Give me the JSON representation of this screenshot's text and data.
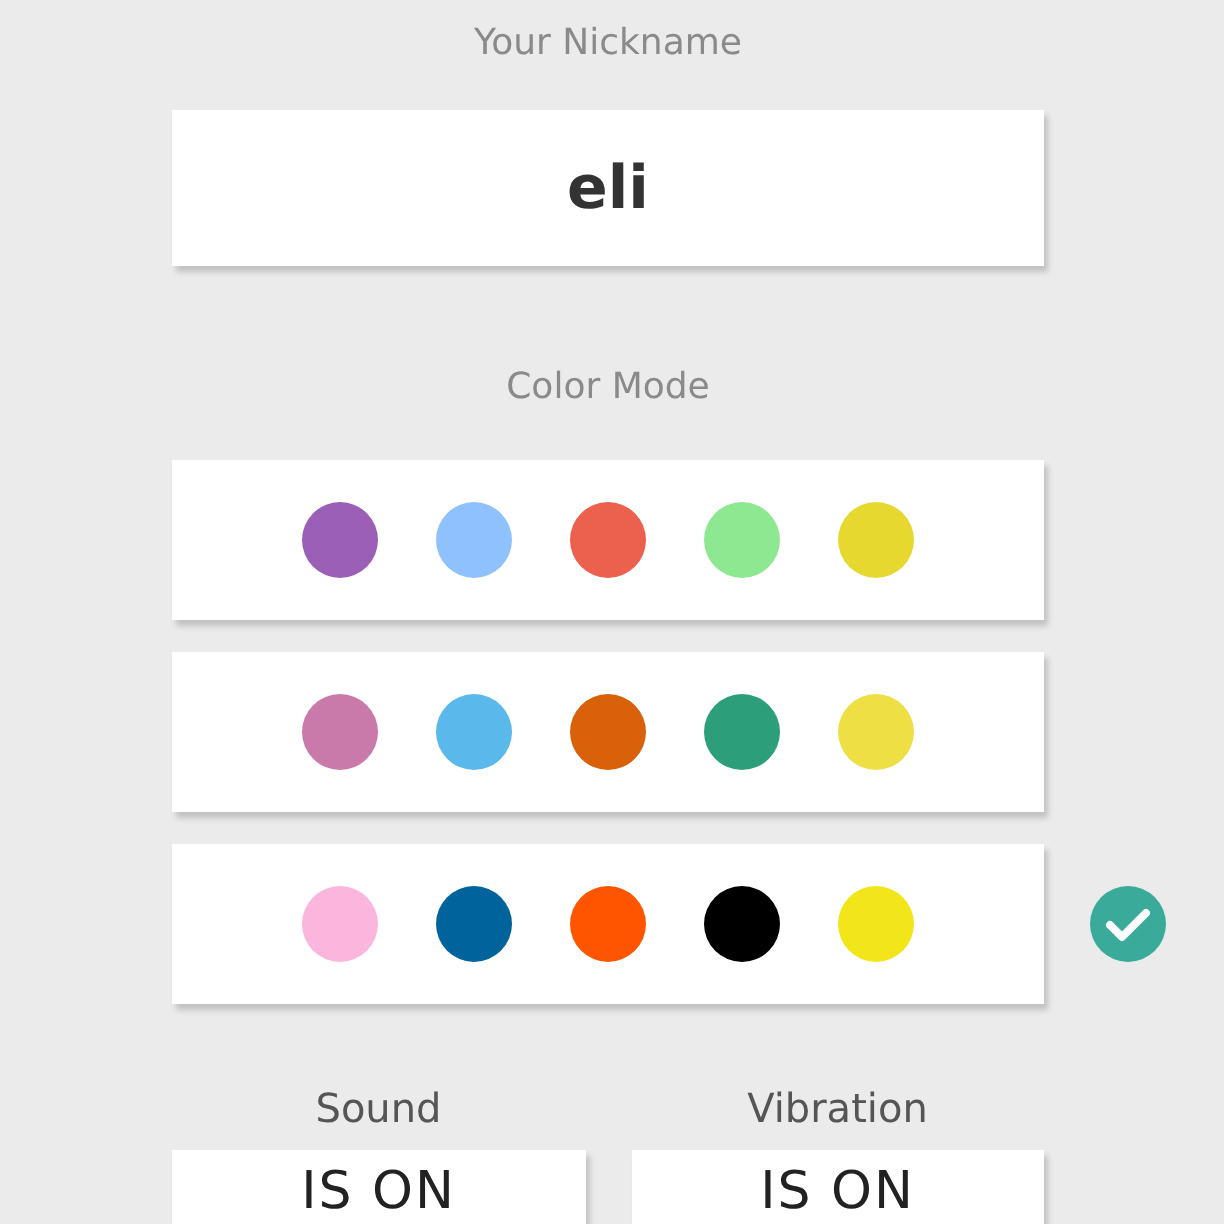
{
  "nickname": {
    "label": "Your Nickname",
    "value": "eli"
  },
  "color_mode": {
    "label": "Color Mode",
    "palettes": [
      {
        "selected": false,
        "swatches": [
          {
            "color": "#9b5fb8"
          },
          {
            "color": "#8fc1ff"
          },
          {
            "color": "#ec604e"
          },
          {
            "color": "#8ee891"
          },
          {
            "color": "#e6d82f"
          }
        ]
      },
      {
        "selected": false,
        "swatches": [
          {
            "color": "#c97aaa"
          },
          {
            "color": "#5ab8ea"
          },
          {
            "color": "#d9610a"
          },
          {
            "color": "#2c9f7a"
          },
          {
            "color": "#eedf45"
          }
        ]
      },
      {
        "selected": true,
        "swatches": [
          {
            "color": "#fbb6dd"
          },
          {
            "color": "#00639b"
          },
          {
            "color": "#ff5500"
          },
          {
            "color": "#000000"
          },
          {
            "color": "#f2e61b"
          }
        ]
      }
    ]
  },
  "toggles": [
    {
      "label": "Sound",
      "value": "IS ON"
    },
    {
      "label": "Vibration",
      "value": "IS ON"
    }
  ]
}
